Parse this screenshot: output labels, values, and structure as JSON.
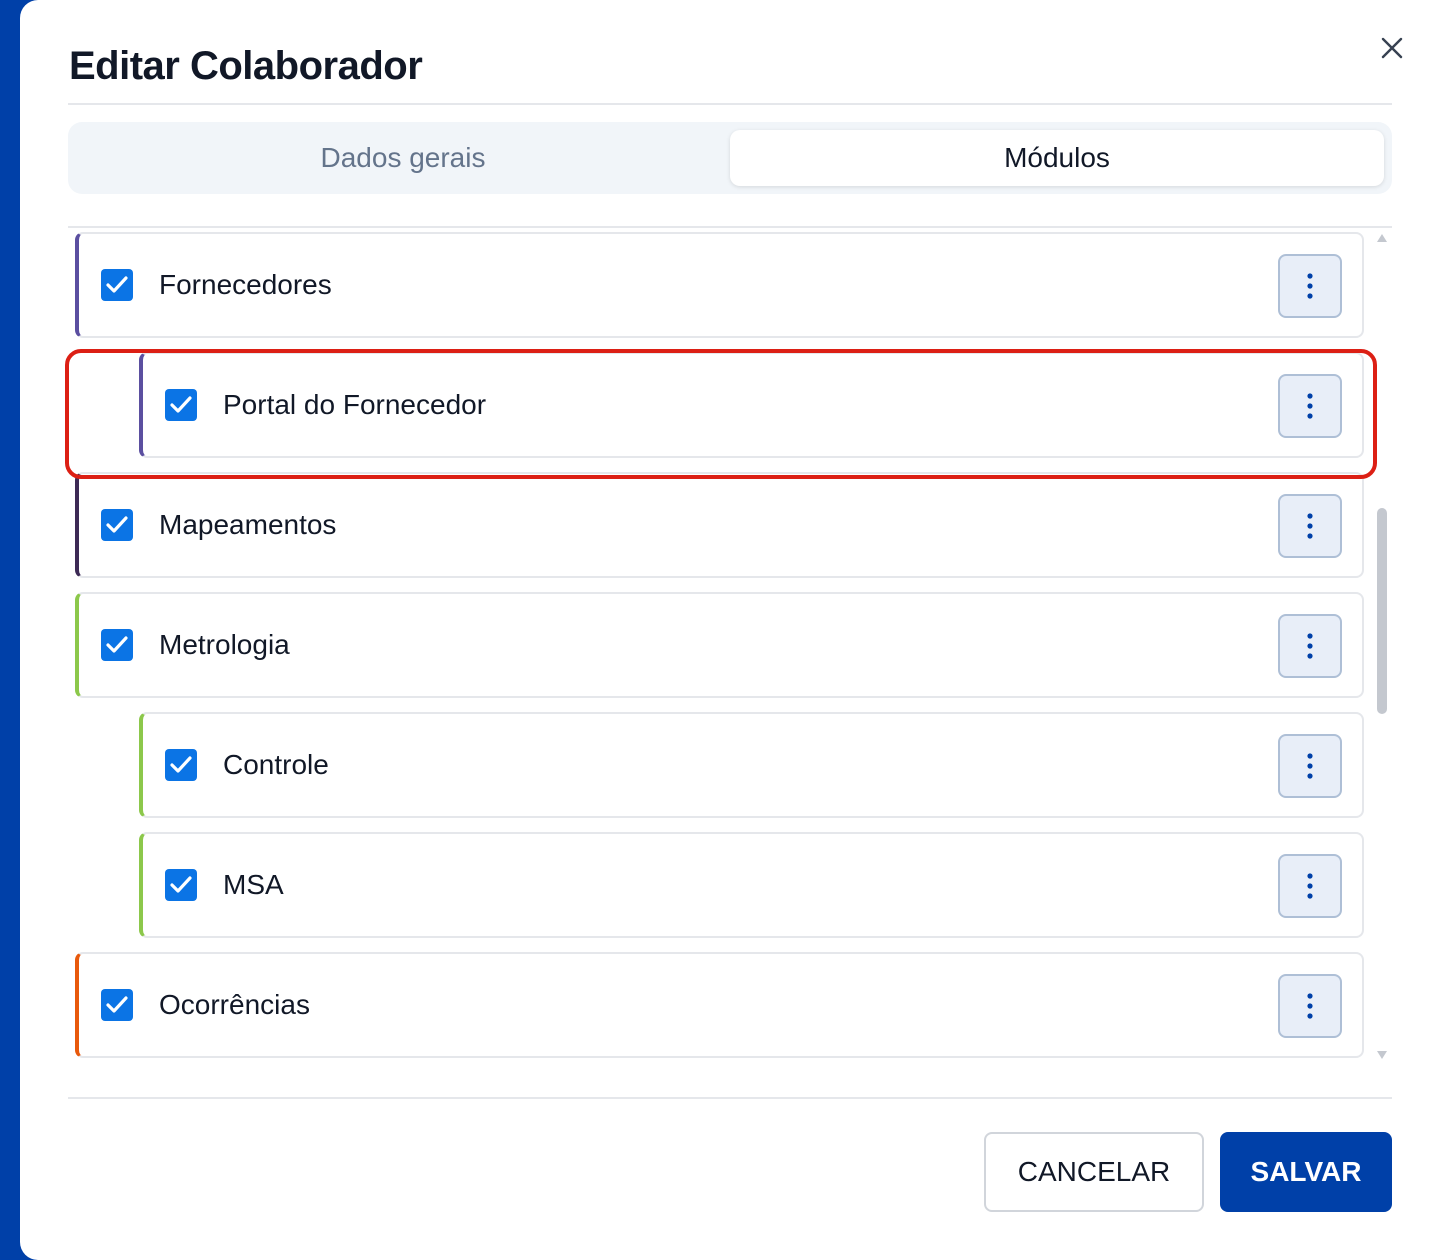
{
  "dialog": {
    "title": "Editar Colaborador"
  },
  "tabs": [
    {
      "label": "Dados gerais",
      "active": false
    },
    {
      "label": "Módulos",
      "active": true
    }
  ],
  "modules": [
    {
      "label": "Fornecedores",
      "level": 1,
      "checked": true,
      "accent": "#5b4fa0"
    },
    {
      "label": "Portal do Fornecedor",
      "level": 2,
      "checked": true,
      "accent": "#5b4fa0"
    },
    {
      "label": "Mapeamentos",
      "level": 1,
      "checked": true,
      "accent": "#3d2a55"
    },
    {
      "label": "Metrologia",
      "level": 1,
      "checked": true,
      "accent": "#8cc84b",
      "highlighted": true
    },
    {
      "label": "Controle",
      "level": 2,
      "checked": true,
      "accent": "#8cc84b"
    },
    {
      "label": "MSA",
      "level": 2,
      "checked": true,
      "accent": "#8cc84b"
    },
    {
      "label": "Ocorrências",
      "level": 1,
      "checked": true,
      "accent": "#e8590c"
    }
  ],
  "footer": {
    "cancel_label": "CANCELAR",
    "save_label": "SALVAR"
  },
  "colors": {
    "primary": "#0040a8",
    "checkbox": "#0b74e5",
    "highlight": "#dc1f14"
  },
  "icons": {
    "close": "close-icon",
    "check": "check-icon",
    "menu": "more-vertical-icon",
    "scroll_up": "triangle-up-icon",
    "scroll_down": "triangle-down-icon"
  }
}
